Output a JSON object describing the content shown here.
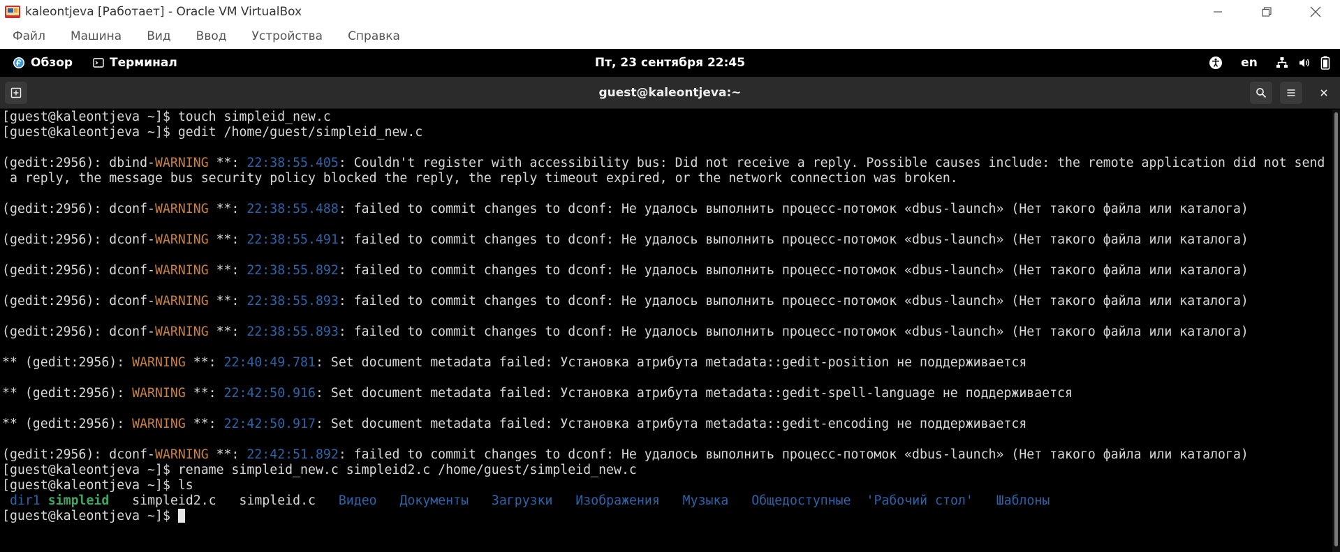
{
  "vbox": {
    "title": "kaleontjeva [Работает] - Oracle VM VirtualBox",
    "menu": [
      "Файл",
      "Машина",
      "Вид",
      "Ввод",
      "Устройства",
      "Справка"
    ]
  },
  "topbar": {
    "overview": "Обзор",
    "app": "Терминал",
    "clock": "Пт, 23 сентября  22:45",
    "lang": "en"
  },
  "terminal": {
    "title": "guest@kaleontjeva:~",
    "prompt": "[guest@kaleontjeva ~]$ ",
    "cmd1": "touch simpleid_new.c",
    "cmd2": "gedit /home/guest/simpleid_new.c",
    "dbind": {
      "prefix": "(gedit:2956): dbind-",
      "level": "WARNING",
      "sep": " **: ",
      "time": "22:38:55.405",
      "msg": ": Couldn't register with accessibility bus: Did not receive a reply. Possible causes include: the remote application did not send",
      "msg2": " a reply, the message bus security policy blocked the reply, the reply timeout expired, or the network connection was broken."
    },
    "dconf_prefix": "(gedit:2956): dconf-",
    "dconf_msg": ": failed to commit changes to dconf: Не удалось выполнить процесс-потомок «dbus-launch» (Нет такого файла или каталога)",
    "dconf_times": [
      "22:38:55.488",
      "22:38:55.491",
      "22:38:55.892",
      "22:38:55.893",
      "22:38:55.893"
    ],
    "meta_prefix": "** (gedit:2956): ",
    "meta": [
      {
        "time": "22:40:49.781",
        "msg": ": Set document metadata failed: Установка атрибута metadata::gedit-position не поддерживается"
      },
      {
        "time": "22:42:50.916",
        "msg": ": Set document metadata failed: Установка атрибута metadata::gedit-spell-language не поддерживается"
      },
      {
        "time": "22:42:50.917",
        "msg": ": Set document metadata failed: Установка атрибута metadata::gedit-encoding не поддерживается"
      }
    ],
    "dconf_last_time": "22:42:51.892",
    "cmd3": "rename simpleid_new.c simpleid2.c /home/guest/simpleid_new.c",
    "cmd4": "ls",
    "ls": [
      {
        "name": "dir1",
        "kind": "dir",
        "pad": " "
      },
      {
        "name": "simpleid",
        "kind": "exe",
        "pad": "   "
      },
      {
        "name": "simpleid2.c",
        "kind": "file",
        "pad": "   "
      },
      {
        "name": "simpleid.c",
        "kind": "file",
        "pad": "   "
      },
      {
        "name": "Видео",
        "kind": "dir",
        "pad": "   "
      },
      {
        "name": "Документы",
        "kind": "dir",
        "pad": "   "
      },
      {
        "name": "Загрузки",
        "kind": "dir",
        "pad": "   "
      },
      {
        "name": "Изображения",
        "kind": "dir",
        "pad": "   "
      },
      {
        "name": "Музыка",
        "kind": "dir",
        "pad": "   "
      },
      {
        "name": "Общедоступные",
        "kind": "dir",
        "pad": "  "
      },
      {
        "name": "'Рабочий стол'",
        "kind": "dir",
        "pad": "   "
      },
      {
        "name": "Шаблоны",
        "kind": "dir",
        "pad": ""
      }
    ]
  }
}
